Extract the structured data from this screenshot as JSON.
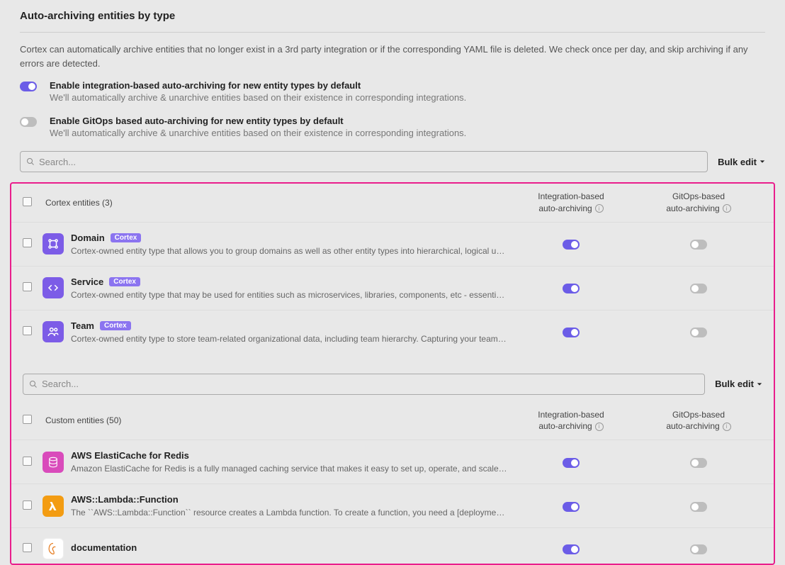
{
  "page": {
    "title": "Auto-archiving entities by type",
    "description": "Cortex can automatically archive entities that no longer exist in a 3rd party integration or if the corresponding YAML file is deleted. We check once per day, and skip archiving if any errors are detected."
  },
  "toggles": {
    "integration": {
      "label": "Enable integration-based auto-archiving for new entity types by default",
      "sub": "We'll automatically archive & unarchive entities based on their existence in corresponding integrations.",
      "on": true
    },
    "gitops": {
      "label": "Enable GitOps based auto-archiving for new entity types by default",
      "sub": "We'll automatically archive & unarchive entities based on their existence in corresponding integrations.",
      "on": false
    }
  },
  "search": {
    "placeholder": "Search..."
  },
  "bulk_edit_label": "Bulk edit",
  "columns": {
    "integration_line1": "Integration-based",
    "integration_line2": "auto-archiving",
    "gitops_line1": "GitOps-based",
    "gitops_line2": "auto-archiving"
  },
  "cortex_section": {
    "header": "Cortex entities (3)",
    "badge": "Cortex",
    "rows": [
      {
        "name": "Domain",
        "desc": "Cortex-owned entity type that allows you to group domains as well as other entity types into hierarchical, logical units...",
        "integration_on": true,
        "gitops_on": false,
        "icon": "domain"
      },
      {
        "name": "Service",
        "desc": "Cortex-owned entity type that may be used for entities such as microservices, libraries, components, etc - essentially...",
        "integration_on": true,
        "gitops_on": false,
        "icon": "service"
      },
      {
        "name": "Team",
        "desc": "Cortex-owned entity type to store team-related organizational data, including team hierarchy. Capturing your team ...",
        "integration_on": true,
        "gitops_on": false,
        "icon": "team"
      }
    ]
  },
  "custom_section": {
    "header": "Custom entities (50)",
    "rows": [
      {
        "name": "AWS ElastiCache for Redis",
        "desc": "Amazon ElastiCache for Redis is a fully managed caching service that makes it easy to set up, operate, and scale a ...",
        "integration_on": true,
        "gitops_on": false,
        "icon": "redis"
      },
      {
        "name": "AWS::Lambda::Function",
        "desc": "The ``AWS::Lambda::Function`` resource creates a Lambda function. To create a function, you need a [deployment ...",
        "integration_on": true,
        "gitops_on": false,
        "icon": "lambda"
      },
      {
        "name": "documentation",
        "desc": "",
        "integration_on": true,
        "gitops_on": false,
        "icon": "doc"
      }
    ]
  }
}
